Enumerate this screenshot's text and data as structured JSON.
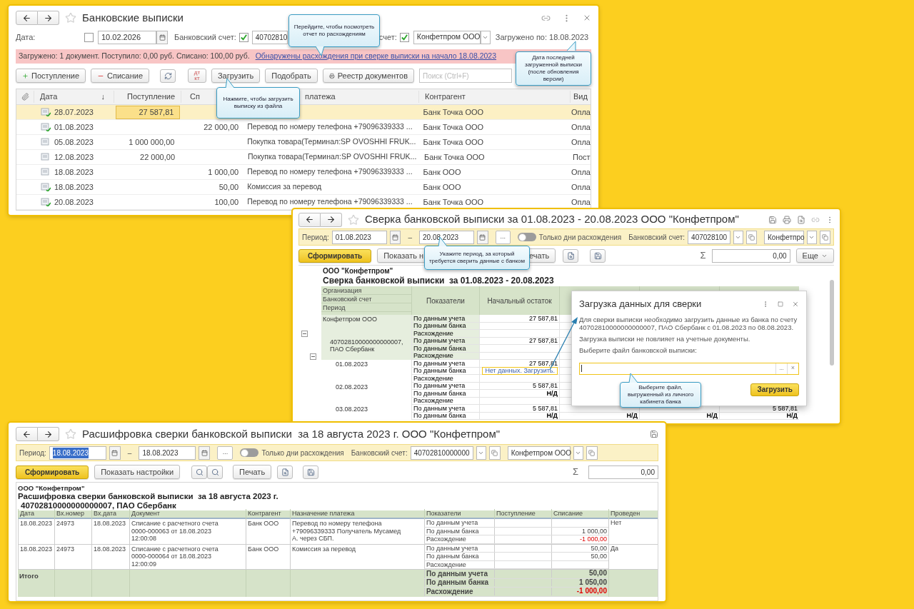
{
  "bank_statements": {
    "title": "Банковские выписки",
    "filters": {
      "date_label": "Дата:",
      "date_checked": false,
      "date": "10.02.2026",
      "account_label": "Банковский счет:",
      "account_checked": true,
      "account": "40702810",
      "org_label": "счет:",
      "org_checked": true,
      "org": "Конфетпром ООО",
      "loaded": "Загружено по: 18.08.2023"
    },
    "notice": {
      "text": "Загружено: 1 документ. Поступило: 0,00 руб. Списано: 100,00 руб.",
      "link": "Обнаружены расхождения при сверке выписки на начало 18.08.2023"
    },
    "toolbar": {
      "receipt": "Поступление",
      "writeoff": "Списание",
      "dt": "дт",
      "kt": "кт",
      "load": "Загрузить",
      "pick": "Подобрать",
      "registry": "Реестр документов",
      "search_placeholder": "Поиск (Ctrl+F)"
    },
    "columns": {
      "date": "Дата",
      "sort": "↓",
      "income": "Поступление",
      "expense": "Сп",
      "purpose": "платежа",
      "counterparty": "Контрагент",
      "type": "Вид"
    },
    "rows": [
      {
        "kind": "posted",
        "selected": true,
        "date": "28.07.2023",
        "income": "27 587,81",
        "counterparty": "Банк Точка ООО",
        "type": "Опла"
      },
      {
        "kind": "posted",
        "selected": false,
        "date": "01.08.2023",
        "expense": "22 000,00",
        "purpose": "Перевод по номеру телефона +79096339333 ...",
        "counterparty": "Банк Точка ООО",
        "type": "Опла"
      },
      {
        "kind": "plain",
        "selected": false,
        "date": "05.08.2023",
        "income": "1 000 000,00",
        "purpose": "Покупка товара(Терминал:SP OVOSHHI FRUK...",
        "counterparty": "Банк Точка ООО",
        "type": "Опла"
      },
      {
        "kind": "plain",
        "selected": false,
        "date": "12.08.2023",
        "income": "22 000,00",
        "purpose": "Покупка товара(Терминал:SP OVOSHHI FRUK...",
        "counterparty": "Банк Точка ООО",
        "type": "Пост"
      },
      {
        "kind": "plain",
        "selected": false,
        "date": "18.08.2023",
        "expense": "1 000,00",
        "purpose": "Перевод по номеру телефона +79096339333 ...",
        "counterparty": "Банк ООО",
        "type": "Опла"
      },
      {
        "kind": "posted",
        "selected": false,
        "date": "18.08.2023",
        "expense": "50,00",
        "purpose": "Комиссия за перевод",
        "counterparty": "Банк ООО",
        "type": "Опла"
      },
      {
        "kind": "posted",
        "selected": false,
        "date": "20.08.2023",
        "expense": "100,00",
        "purpose": "Перевод по номеру телефона +79096339333 ...",
        "counterparty": "Банк Точка ООО",
        "type": "Опла"
      }
    ]
  },
  "reconciliation": {
    "title": "Сверка банковской выписки за 01.08.2023 - 20.08.2023 ООО \"Конфетпром\"",
    "filters": {
      "period_label": "Период:",
      "date_from": "01.08.2023",
      "dash": "–",
      "date_to": "20.08.2023",
      "more": "...",
      "only_diff_label": "Только дни расхождения",
      "only_diff_on": false,
      "account_label": "Банковский счет:",
      "account": "407028100",
      "org": "Конфетпро"
    },
    "toolbar": {
      "generate": "Сформировать",
      "settings": "Показать н",
      "print": "ечать",
      "sigma": "Σ",
      "sum": "0,00",
      "more": "Еще"
    },
    "report": {
      "org": "ООО \"Конфетпром\"",
      "title": "Сверка банковской выписки  за 01.08.2023 - 20.08.2023",
      "header_left": [
        "Организация",
        "Банковский счет",
        "Период"
      ],
      "header_indicators": "Показатели",
      "header_start": "Начальный остаток",
      "tree": [
        {
          "label": "Конфетпром ООО",
          "expanded": true,
          "lines": [
            {
              "indicator": "По данным учета",
              "start": "27 587,81"
            },
            {
              "indicator": "По данным банка"
            },
            {
              "indicator": "Расхождение"
            }
          ],
          "children": [
            {
              "label": "40702810000000000007, ПАО Сбербанк",
              "expanded": true,
              "lines": [
                {
                  "indicator": "По данным учета",
                  "start": "27 587,81"
                },
                {
                  "indicator": "По данным банка"
                },
                {
                  "indicator": "Расхождение"
                }
              ],
              "children": [
                {
                  "label": "01.08.2023",
                  "lines": [
                    {
                      "indicator": "По данным учета",
                      "start": "27 587,81"
                    },
                    {
                      "indicator": "По данным банка",
                      "link": "Нет данных. Загрузить."
                    },
                    {
                      "indicator": "Расхождение"
                    }
                  ]
                },
                {
                  "label": "02.08.2023",
                  "lines": [
                    {
                      "indicator": "По данным учета",
                      "start": "5 587,81"
                    },
                    {
                      "indicator": "По данным банка",
                      "start": "Н/Д"
                    },
                    {
                      "indicator": "Расхождение"
                    }
                  ]
                },
                {
                  "label": "03.08.2023",
                  "lines": [
                    {
                      "indicator": "По данным учета",
                      "start": "5 587,81",
                      "col_4": "5 587,81"
                    },
                    {
                      "indicator": "По данным банка",
                      "start": "Н/Д",
                      "col_2": "Н/Д",
                      "col_3": "Н/Д",
                      "col_4": "Н/Д"
                    }
                  ]
                }
              ]
            }
          ]
        }
      ]
    },
    "dialog": {
      "title": "Загрузка данных для сверки",
      "text": "Для сверки выписки необходимо загрузить данные из банка по счету 40702810000000000007, ПАО Сбербанк с 01.08.2023 по 08.08.2023.",
      "note": "Загрузка выписки не повлияет на учетные документы.",
      "file_label": "Выберите файл банковской выписки:",
      "browse": "...",
      "clear": "×",
      "load": "Загрузить"
    }
  },
  "breakdown": {
    "title": "Расшифровка сверки банковской выписки  за 18 августа 2023 г. ООО \"Конфетпром\"",
    "filters": {
      "period_label": "Период:",
      "date_from": "18.08.2023",
      "date_from_selected": true,
      "dash": "–",
      "date_to": "18.08.2023",
      "more": "...",
      "only_diff_label": "Только дни расхождения",
      "only_diff_on": false,
      "account_label": "Банковский счет:",
      "account": "40702810000000",
      "org": "Конфетпром ООО"
    },
    "toolbar": {
      "generate": "Сформировать",
      "settings": "Показать настройки",
      "print": "Печать",
      "sigma": "Σ",
      "sum": "0,00"
    },
    "report": {
      "org": "ООО \"Конфетпром\"",
      "title": "Расшифровка сверки банковской выписки  за 18 августа 2023 г.",
      "account": "40702810000000000007, ПАО Сбербанк",
      "columns": [
        "Дата",
        "Вх.номер",
        "Вх.дата",
        "Документ",
        "Контрагент",
        "Назначение платежа",
        "Показатели",
        "Поступление",
        "Списание",
        "Проведен"
      ],
      "rows": [
        {
          "date": "18.08.2023",
          "in_no": "24973",
          "in_date": "18.08.2023",
          "document": "Списание с расчетного счета 0000-000063 от 18.08.2023 12:00:08",
          "counterparty": "Банк ООО",
          "purpose": "Перевод по номеру телефона +79096339333 Получатель Мусамед А. через СБП.",
          "posted": "Нет",
          "lines": [
            {
              "indicator": "По данным учета"
            },
            {
              "indicator": "По данным банка",
              "expense": "1 000,00",
              "negative": false
            },
            {
              "indicator": "Расхождение",
              "expense": "-1 000,00",
              "negative": true
            }
          ]
        },
        {
          "date": "18.08.2023",
          "in_no": "24973",
          "in_date": "18.08.2023",
          "document": "Списание с расчетного счета 0000-000064 от 18.08.2023 12:00:09",
          "counterparty": "Банк ООО",
          "purpose": "Комиссия за перевод",
          "posted": "Да",
          "lines": [
            {
              "indicator": "По данным учета",
              "expense": "50,00",
              "negative": false
            },
            {
              "indicator": "По данным банка",
              "expense": "50,00",
              "negative": false
            },
            {
              "indicator": "Расхождение"
            }
          ]
        }
      ],
      "totals": {
        "label": "Итого",
        "lines": [
          {
            "indicator": "По данным учета",
            "expense": "50,00",
            "negative": false
          },
          {
            "indicator": "По данным банка",
            "expense": "1 050,00",
            "negative": false
          },
          {
            "indicator": "Расхождение",
            "expense": "-1 000,00",
            "negative": true
          }
        ]
      }
    }
  },
  "callouts": [
    "Перейдите, чтобы посмотреть отчет по расхождениям",
    "Нажмите, чтобы загрузить выписку из файла",
    "Дата последней загруженной выписки (после обновления версии)",
    "Укажите период, за который требуется сверить данные с банком",
    "Выберите файл, выгруженный из личного кабинета банка"
  ]
}
